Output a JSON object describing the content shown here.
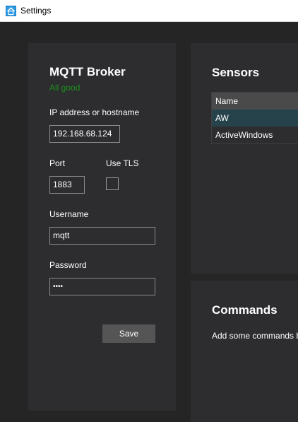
{
  "window": {
    "title": "Settings",
    "icon": "home-icon"
  },
  "mqtt": {
    "title": "MQTT Broker",
    "status": "All good",
    "status_color": "#1a8f1a",
    "host_label": "IP address or hostname",
    "host_value": "192.168.68.124",
    "port_label": "Port",
    "port_value": "1883",
    "tls_label": "Use TLS",
    "tls_checked": false,
    "username_label": "Username",
    "username_value": "mqtt",
    "password_label": "Password",
    "password_value": "••••",
    "save_label": "Save"
  },
  "sensors": {
    "title": "Sensors",
    "columns": [
      "Name"
    ],
    "rows": [
      {
        "name": "AW",
        "selected": true
      },
      {
        "name": "ActiveWindows",
        "selected": false
      }
    ]
  },
  "commands": {
    "title": "Commands",
    "hint": "Add some commands b"
  }
}
